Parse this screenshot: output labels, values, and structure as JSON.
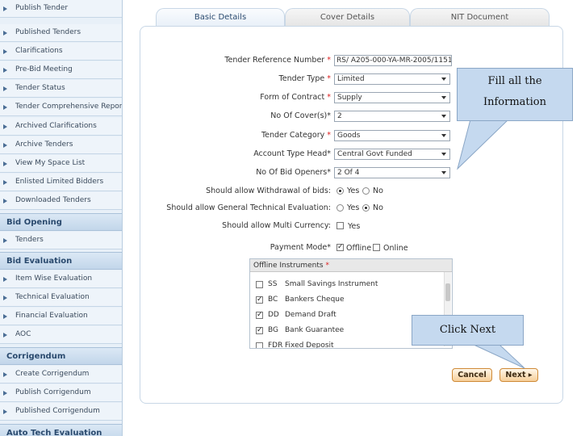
{
  "sidebar": {
    "items_top": [
      "Publish Tender",
      "Published Tenders",
      "Clarifications",
      "Pre-Bid Meeting",
      "Tender Status",
      "Tender Comprehensive Report",
      "Archived Clarifications",
      "Archive Tenders",
      "View My Space List",
      "Enlisted Limited Bidders",
      "Downloaded Tenders"
    ],
    "sections": [
      {
        "title": "Bid Opening",
        "items": [
          "Tenders"
        ]
      },
      {
        "title": "Bid Evaluation",
        "items": [
          "Item Wise Evaluation",
          "Technical Evaluation",
          "Financial Evaluation",
          "AOC"
        ]
      },
      {
        "title": "Corrigendum",
        "items": [
          "Create Corrigendum",
          "Publish Corrigendum",
          "Published Corrigendum"
        ]
      },
      {
        "title": "Auto Tech Evaluation",
        "items": []
      }
    ]
  },
  "tabs": [
    "Basic Details",
    "Cover Details",
    "NIT Document"
  ],
  "form": {
    "tender_ref": {
      "label": "Tender Reference Number",
      "value": "RS/ A205-000-YA-MR-2005/1151"
    },
    "tender_type": {
      "label": "Tender Type",
      "value": "Limited"
    },
    "form_contract": {
      "label": "Form of Contract",
      "value": "Supply"
    },
    "no_covers": {
      "label": "No Of Cover(s)*",
      "value": "2"
    },
    "tender_category": {
      "label": "Tender Category",
      "value": "Goods"
    },
    "account_head": {
      "label": "Account Type Head*",
      "value": "Central Govt Funded"
    },
    "bid_openers": {
      "label": "No Of Bid Openers*",
      "value": "2 Of 4"
    },
    "withdrawal": {
      "label": "Should allow Withdrawal of bids:",
      "yes": "Yes",
      "no": "No"
    },
    "gen_tech_eval": {
      "label": "Should allow General Technical Evaluation:",
      "yes": "Yes",
      "no": "No"
    },
    "multi_currency": {
      "label": "Should allow Multi Currency:",
      "yes": "Yes"
    },
    "payment_mode": {
      "label": "Payment Mode*",
      "offline": "Offline",
      "online": "Online"
    }
  },
  "offline_instruments": {
    "title": "Offline Instruments",
    "rows": [
      {
        "code": "SS",
        "name": "Small Savings Instrument",
        "checked": false
      },
      {
        "code": "BC",
        "name": "Bankers Cheque",
        "checked": true
      },
      {
        "code": "DD",
        "name": "Demand Draft",
        "checked": true
      },
      {
        "code": "BG",
        "name": "Bank Guarantee",
        "checked": true
      },
      {
        "code": "FDR",
        "name": "Fixed Deposit",
        "checked": false
      }
    ]
  },
  "buttons": {
    "cancel": "Cancel",
    "next": "Next"
  },
  "callouts": {
    "fill_1": "Fill all the",
    "fill_2": "Information",
    "next": "Click Next"
  },
  "colors": {
    "callout_bg": "#c5d9ef",
    "button_border": "#cf8a37",
    "required": "#d22222"
  }
}
